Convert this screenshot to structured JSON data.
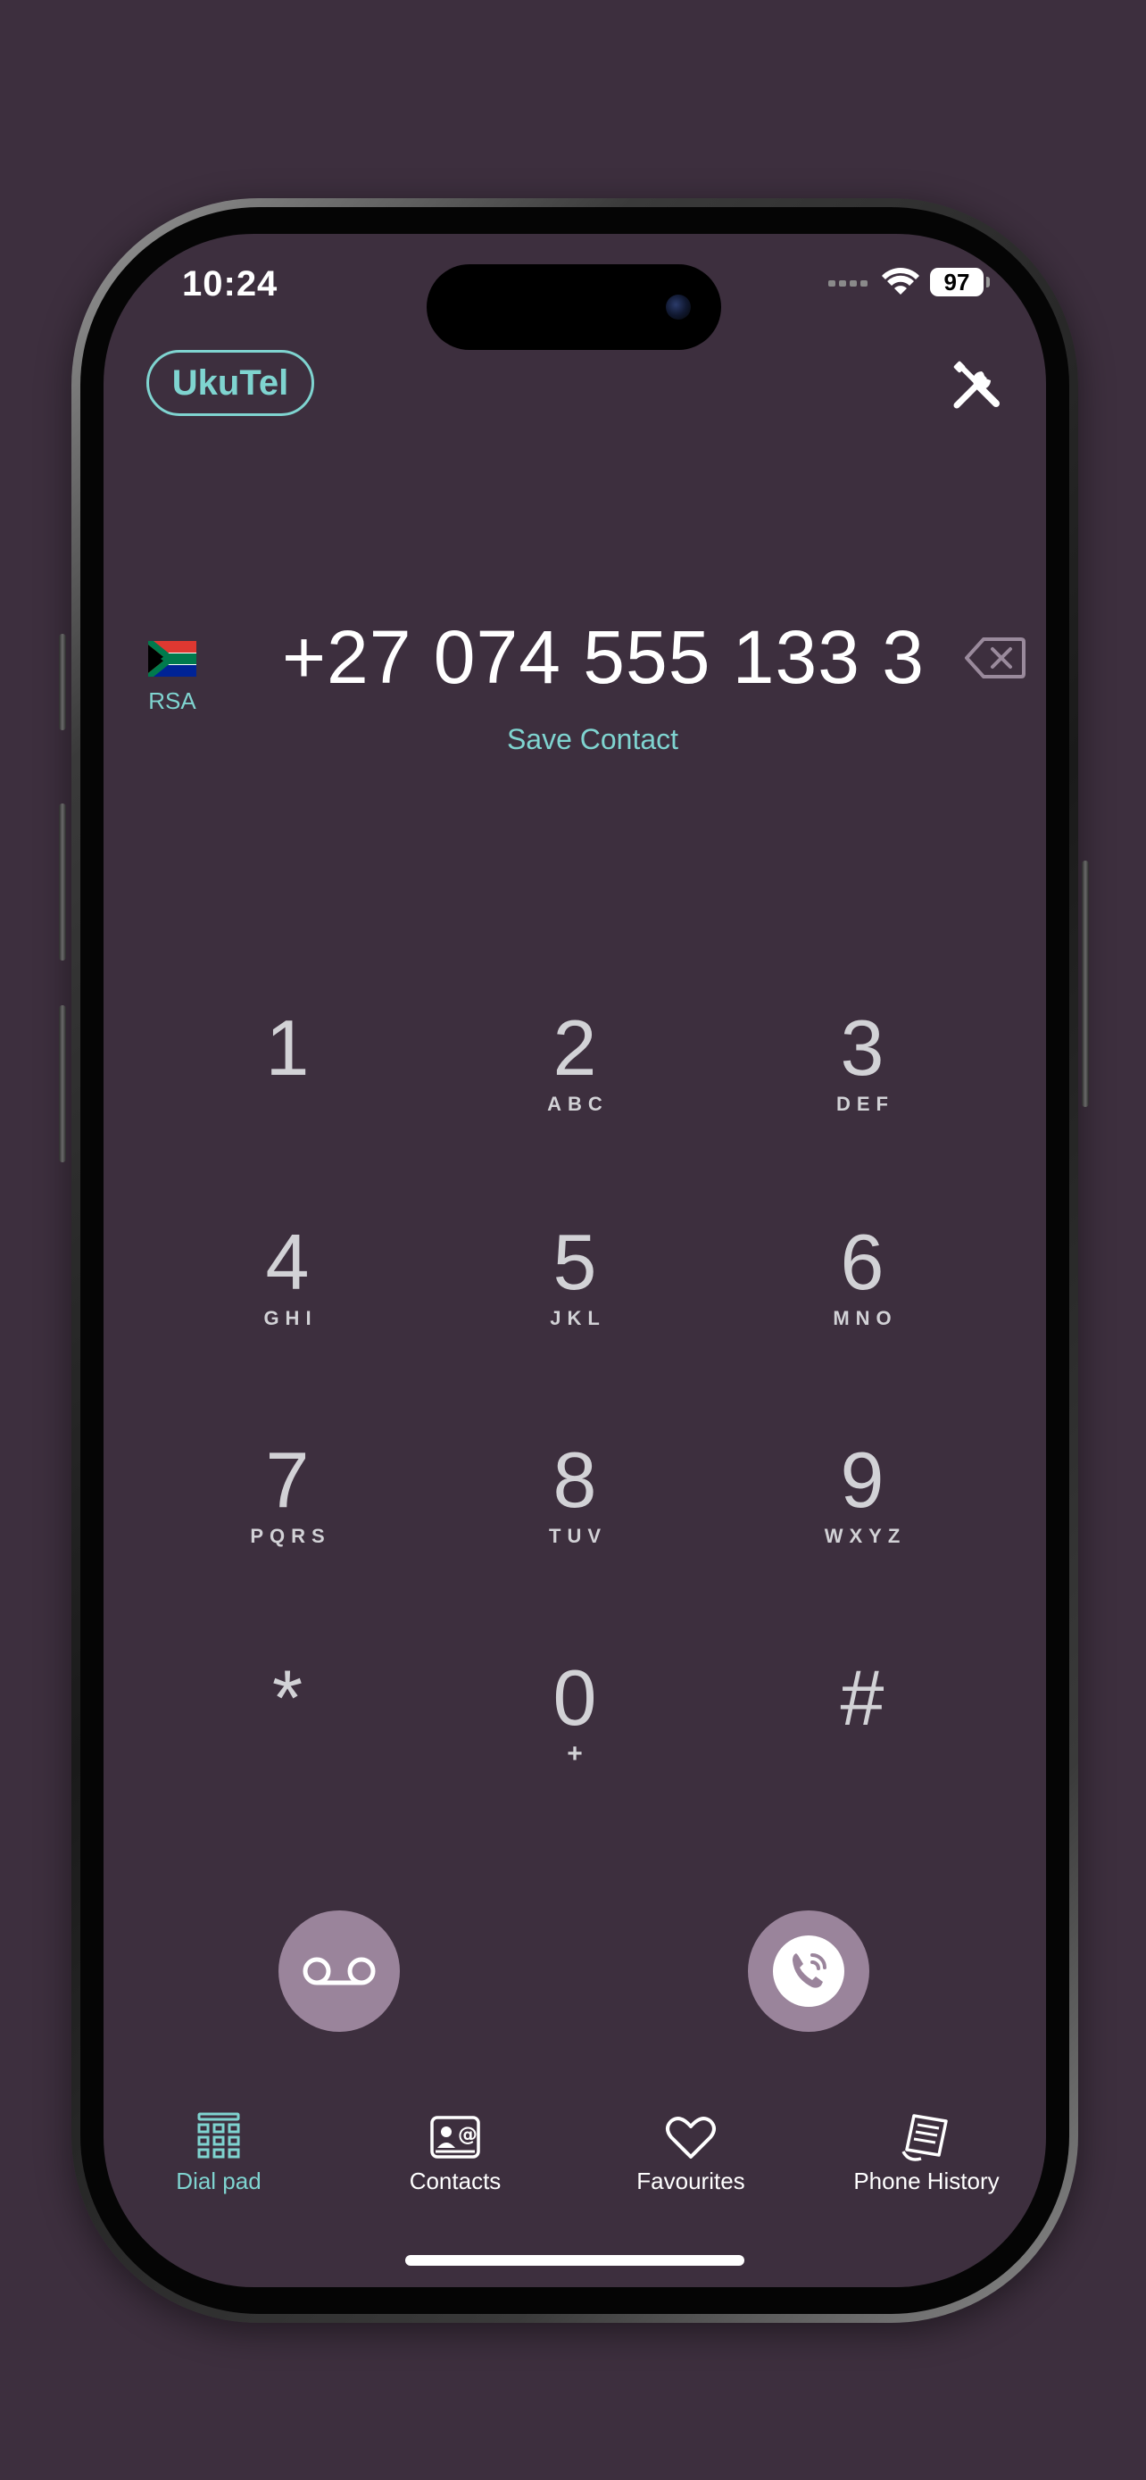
{
  "status_bar": {
    "time": "10:24",
    "battery": "97"
  },
  "header": {
    "app_name": "UkuTel",
    "settings_icon": "tools-icon"
  },
  "dialer": {
    "country_code_label": "RSA",
    "country_flag": "south-africa-flag",
    "number": "+27 074 555 133 3",
    "save_contact_label": "Save Contact"
  },
  "keypad": {
    "keys": [
      {
        "digit": "1",
        "letters": ""
      },
      {
        "digit": "2",
        "letters": "ABC"
      },
      {
        "digit": "3",
        "letters": "DEF"
      },
      {
        "digit": "4",
        "letters": "GHI"
      },
      {
        "digit": "5",
        "letters": "JKL"
      },
      {
        "digit": "6",
        "letters": "MNO"
      },
      {
        "digit": "7",
        "letters": "PQRS"
      },
      {
        "digit": "8",
        "letters": "TUV"
      },
      {
        "digit": "9",
        "letters": "WXYZ"
      },
      {
        "digit": "*",
        "letters": ""
      },
      {
        "digit": "0",
        "letters": "+"
      },
      {
        "digit": "#",
        "letters": ""
      }
    ]
  },
  "actions": {
    "voicemail_icon": "voicemail-icon",
    "call_icon": "phone-call-icon"
  },
  "tabs": [
    {
      "label": "Dial pad",
      "icon": "dialpad-icon",
      "active": true
    },
    {
      "label": "Contacts",
      "icon": "contact-card-icon",
      "active": false
    },
    {
      "label": "Favourites",
      "icon": "heart-icon",
      "active": false
    },
    {
      "label": "Phone History",
      "icon": "history-list-icon",
      "active": false
    }
  ],
  "colors": {
    "background": "#3d2f3e",
    "accent": "#7fd4d0",
    "action_button": "#9a849b",
    "key_text": "#d2d2d6"
  }
}
